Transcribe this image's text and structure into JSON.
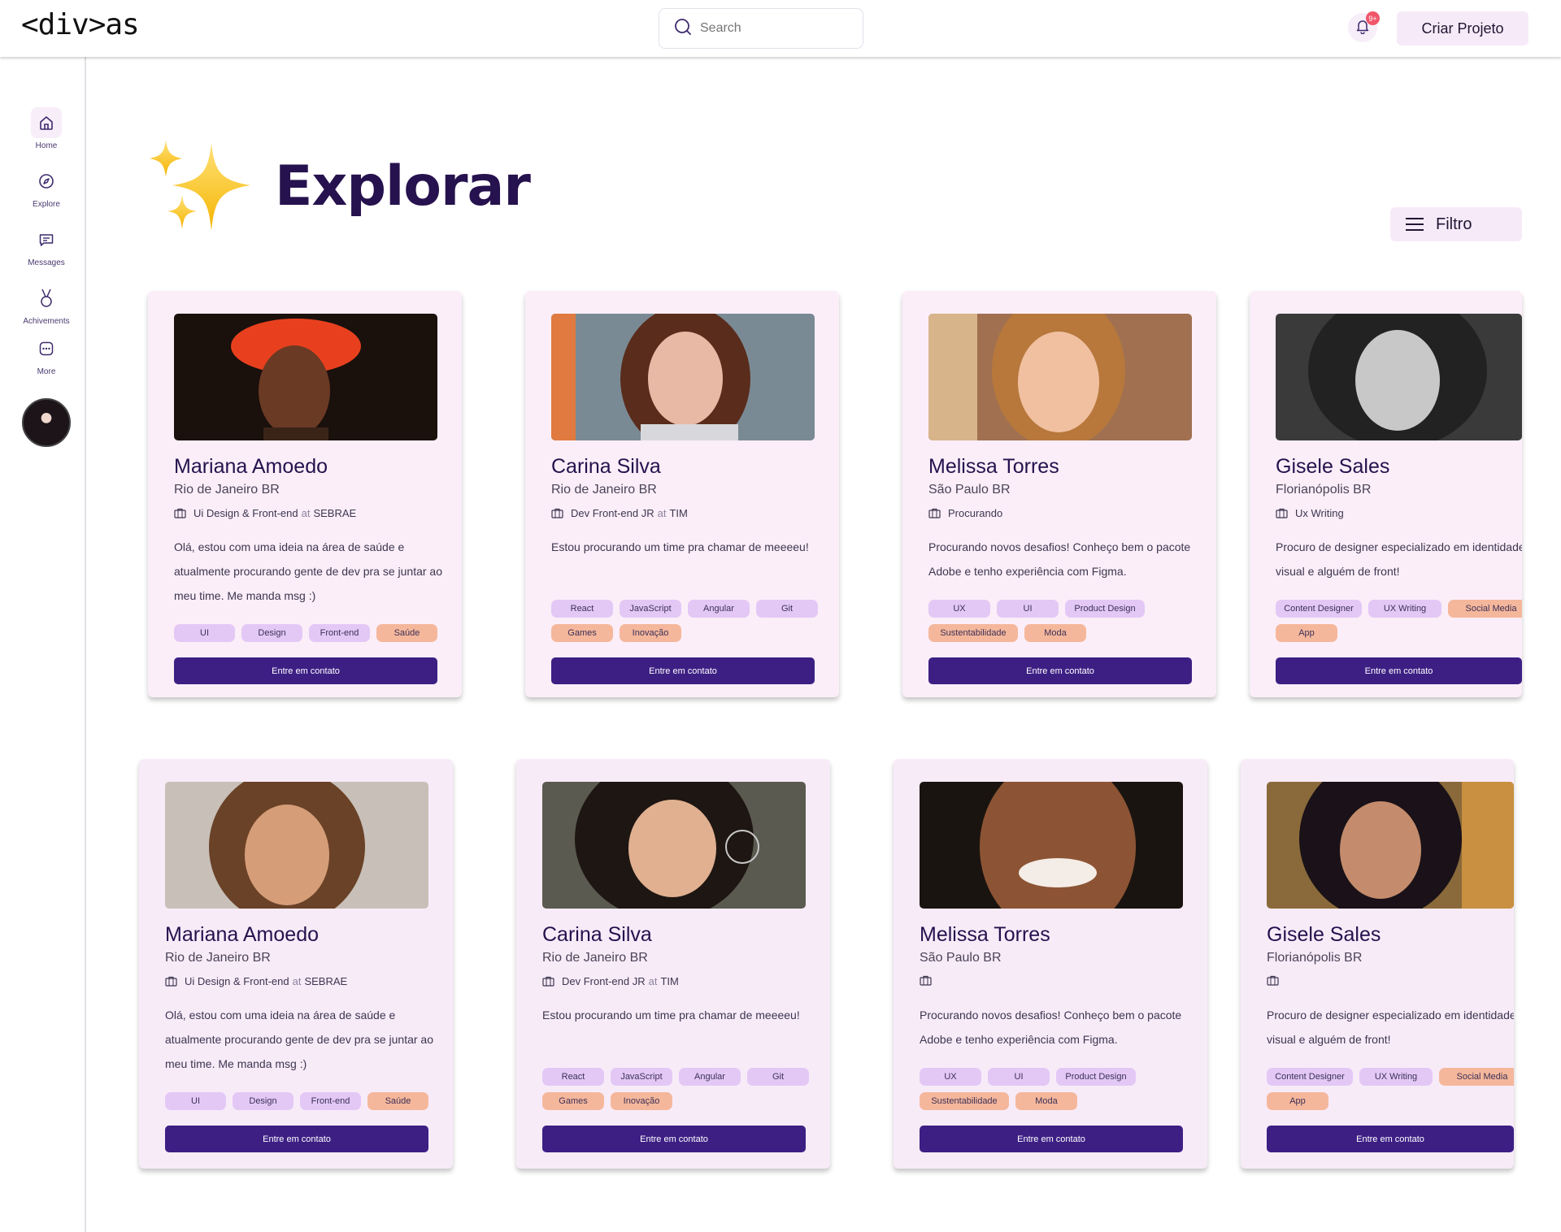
{
  "header": {
    "logo": "<div>as",
    "search_placeholder": "Search",
    "notification_badge": "9+",
    "create_button": "Criar Projeto"
  },
  "sidebar": {
    "items": [
      {
        "label": "Home",
        "icon": "home-icon",
        "active": true
      },
      {
        "label": "Explore",
        "icon": "compass-icon",
        "active": false
      },
      {
        "label": "Messages",
        "icon": "message-icon",
        "active": false
      },
      {
        "label": "Achivements",
        "icon": "medal-icon",
        "active": false
      },
      {
        "label": "More",
        "icon": "more-icon",
        "active": false
      }
    ]
  },
  "page": {
    "title": "Explorar",
    "filter_button": "Filtro"
  },
  "cards": [
    {
      "name": "Mariana Amoedo",
      "location": "Rio de Janeiro BR",
      "role": "Ui Design & Front-end",
      "at": "at",
      "company": "SEBRAE",
      "bio": "Olá, estou com uma ideia na área de saúde e atualmente procurando gente de dev pra se juntar ao meu time. Me manda msg :)",
      "tags": [
        {
          "label": "UI",
          "kind": "p"
        },
        {
          "label": "Design",
          "kind": "p"
        },
        {
          "label": "Front-end",
          "kind": "p"
        },
        {
          "label": "Saúde",
          "kind": "o"
        }
      ],
      "cta": "Entre em contato"
    },
    {
      "name": "Carina Silva",
      "location": "Rio de Janeiro BR",
      "role": "Dev Front-end JR",
      "at": "at",
      "company": "TIM",
      "bio": "Estou procurando um time pra chamar de meeeeu!",
      "tags": [
        {
          "label": "React",
          "kind": "p"
        },
        {
          "label": "JavaScript",
          "kind": "p"
        },
        {
          "label": "Angular",
          "kind": "p"
        },
        {
          "label": "Git",
          "kind": "p"
        },
        {
          "label": "Games",
          "kind": "o"
        },
        {
          "label": "Inovação",
          "kind": "o"
        }
      ],
      "cta": "Entre em contato"
    },
    {
      "name": "Melissa Torres",
      "location": "São Paulo BR",
      "role": "Procurando",
      "at": "",
      "company": "",
      "bio": "Procurando novos desafios! Conheço bem o pacote Adobe e tenho experiência com Figma.",
      "tags": [
        {
          "label": "UX",
          "kind": "p"
        },
        {
          "label": "UI",
          "kind": "p"
        },
        {
          "label": "Product Design",
          "kind": "p"
        },
        {
          "label": "Sustentabilidade",
          "kind": "o"
        },
        {
          "label": "Moda",
          "kind": "o"
        }
      ],
      "cta": "Entre em contato"
    },
    {
      "name": "Gisele Sales",
      "location": "Florianópolis BR",
      "role": "Ux Writing",
      "at": "",
      "company": "",
      "bio": "Procuro de designer especializado em identidade visual e alguém de front!",
      "tags": [
        {
          "label": "Content Designer",
          "kind": "p"
        },
        {
          "label": "UX Writing",
          "kind": "p"
        },
        {
          "label": "Social Media",
          "kind": "o"
        },
        {
          "label": "App",
          "kind": "o"
        }
      ],
      "cta": "Entre em contato"
    },
    {
      "name": "Mariana Amoedo",
      "location": "Rio de Janeiro BR",
      "role": "Ui Design & Front-end",
      "at": "at",
      "company": "SEBRAE",
      "bio": "Olá, estou com uma ideia na área de saúde e atualmente procurando gente de dev pra se juntar ao meu time. Me manda msg :)",
      "tags": [
        {
          "label": "UI",
          "kind": "p"
        },
        {
          "label": "Design",
          "kind": "p"
        },
        {
          "label": "Front-end",
          "kind": "p"
        },
        {
          "label": "Saúde",
          "kind": "o"
        }
      ],
      "cta": "Entre em contato"
    },
    {
      "name": "Carina Silva",
      "location": "Rio de Janeiro BR",
      "role": "Dev Front-end JR",
      "at": "at",
      "company": "TIM",
      "bio": "Estou procurando um time pra chamar de meeeeu!",
      "tags": [
        {
          "label": "React",
          "kind": "p"
        },
        {
          "label": "JavaScript",
          "kind": "p"
        },
        {
          "label": "Angular",
          "kind": "p"
        },
        {
          "label": "Git",
          "kind": "p"
        },
        {
          "label": "Games",
          "kind": "o"
        },
        {
          "label": "Inovação",
          "kind": "o"
        }
      ],
      "cta": "Entre em contato"
    },
    {
      "name": "Melissa Torres",
      "location": "São Paulo BR",
      "role": "",
      "at": "",
      "company": "",
      "bio": "Procurando novos desafios! Conheço bem o pacote Adobe e tenho experiência com Figma.",
      "tags": [
        {
          "label": "UX",
          "kind": "p"
        },
        {
          "label": "UI",
          "kind": "p"
        },
        {
          "label": "Product Design",
          "kind": "p"
        },
        {
          "label": "Sustentabilidade",
          "kind": "o"
        },
        {
          "label": "Moda",
          "kind": "o"
        }
      ],
      "cta": "Entre em contato"
    },
    {
      "name": "Gisele Sales",
      "location": "Florianópolis BR",
      "role": "",
      "at": "",
      "company": "",
      "bio": "Procuro de designer especializado em identidade visual e alguém de front!",
      "tags": [
        {
          "label": "Content Designer",
          "kind": "p"
        },
        {
          "label": "UX Writing",
          "kind": "p"
        },
        {
          "label": "Social Media",
          "kind": "o"
        },
        {
          "label": "App",
          "kind": "o"
        }
      ],
      "cta": "Entre em contato"
    }
  ],
  "colors": {
    "accent": "#3d1f84",
    "title": "#26124e",
    "card_bg": "#fbeef8",
    "tag_purple": "#e3c8f6",
    "tag_orange": "#f5b79b"
  }
}
